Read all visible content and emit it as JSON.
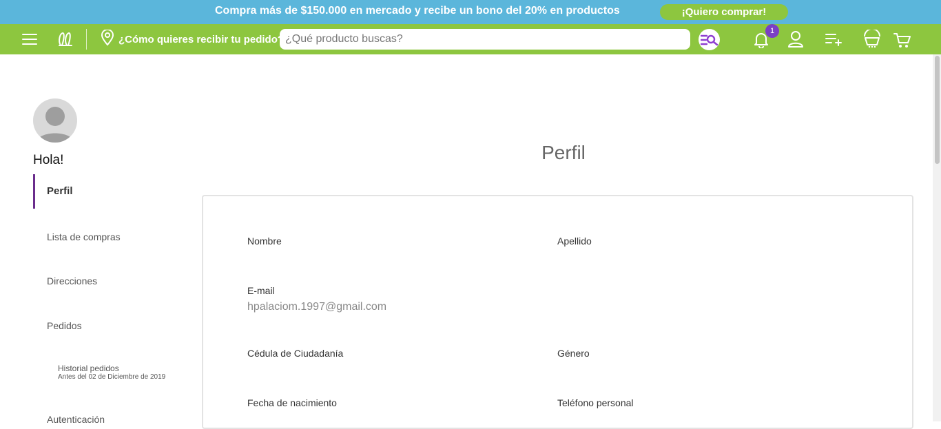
{
  "promo": {
    "text": "Compra más de $150.000 en mercado y recibe un bono del 20% en productos",
    "button_label": "¡Quiero comprar!"
  },
  "header": {
    "delivery_prompt": "¿Cómo quieres recibir tu pedido?",
    "search_placeholder": "¿Qué producto buscas?",
    "notification_count": "1",
    "icons": [
      "menu-icon",
      "logo-icon",
      "location-pin-icon",
      "search-list-icon",
      "bell-icon",
      "user-icon",
      "add-list-icon",
      "basket-icon",
      "cart-icon"
    ]
  },
  "sidebar": {
    "greeting": "Hola!",
    "items": [
      {
        "label": "Perfil",
        "active": true
      },
      {
        "label": "Lista de compras"
      },
      {
        "label": "Direcciones"
      },
      {
        "label": "Pedidos"
      },
      {
        "label": "Autenticación"
      }
    ],
    "history": {
      "label": "Historial pedidos",
      "sublabel": "Antes del 02 de Diciembre de 2019"
    }
  },
  "main": {
    "title": "Perfil",
    "fields": {
      "nombre": "Nombre",
      "apellido": "Apellido",
      "email_label": "E-mail",
      "email_value": "hpalaciom.1997@gmail.com",
      "cedula": "Cédula de Ciudadanía",
      "genero": "Género",
      "fecha": "Fecha de nacimiento",
      "telefono": "Teléfono personal"
    }
  },
  "colors": {
    "promo_bg": "#5bb6db",
    "nav_bg": "#8dc63f",
    "accent_purple": "#6a2c8c",
    "badge": "#7b3fc4"
  }
}
